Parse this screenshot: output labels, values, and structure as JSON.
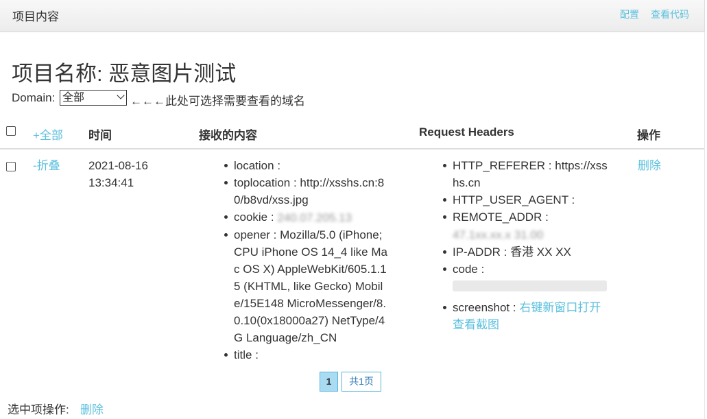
{
  "topbar": {
    "brand": "项目内容",
    "config_link": "配置",
    "view_code_link": "查看代码"
  },
  "project": {
    "title": "项目名称: 恶意图片测试"
  },
  "domain_filter": {
    "label": "Domain:",
    "selected": "全部",
    "hint": "←←←此处可选择需要查看的域名"
  },
  "table": {
    "headers": {
      "expand_all": "+全部",
      "time": "时间",
      "content": "接收的内容",
      "request_headers": "Request Headers",
      "actions": "操作"
    },
    "row": {
      "toggle": "-折叠",
      "date": "2021-08-16",
      "time": "13:34:41",
      "content": [
        {
          "key": "location",
          "value": ""
        },
        {
          "key": "toplocation",
          "value": "http://xsshs.cn:80/b8vd/xss.jpg"
        },
        {
          "key": "cookie",
          "value": "240.07.205.13"
        },
        {
          "key": "opener",
          "value": "Mozilla/5.0 (iPhone; CPU iPhone OS 14_4 like Mac OS X) AppleWebKit/605.1.15 (KHTML, like Gecko) Mobile/15E148 MicroMessenger/8.0.10(0x18000a27) NetType/4G Language/zh_CN"
        },
        {
          "key": "title",
          "value": ""
        }
      ],
      "headers": {
        "referer_key": "HTTP_REFERER",
        "referer_value": "https://xsshs.cn",
        "ua_key": "HTTP_USER_AGENT",
        "ua_value": "",
        "remote_key": "REMOTE_ADDR",
        "remote_value": "47.1xx.xx.x 31.00",
        "ipaddr_key": "IP-ADDR",
        "ipaddr_value": "香港 XX XX",
        "code_key": "code",
        "screenshot_key": "screenshot",
        "screenshot_link": "右键新窗口打开查看截图"
      },
      "delete_action": "删除"
    }
  },
  "pagination": {
    "current": "1",
    "total": "共1页"
  },
  "footer": {
    "label": "选中项操作:",
    "delete_link": "删除"
  },
  "colors": {
    "link": "#5bc0de",
    "pager_active_bg": "#a9dcf3",
    "header_bg": "#f2f2f2"
  }
}
